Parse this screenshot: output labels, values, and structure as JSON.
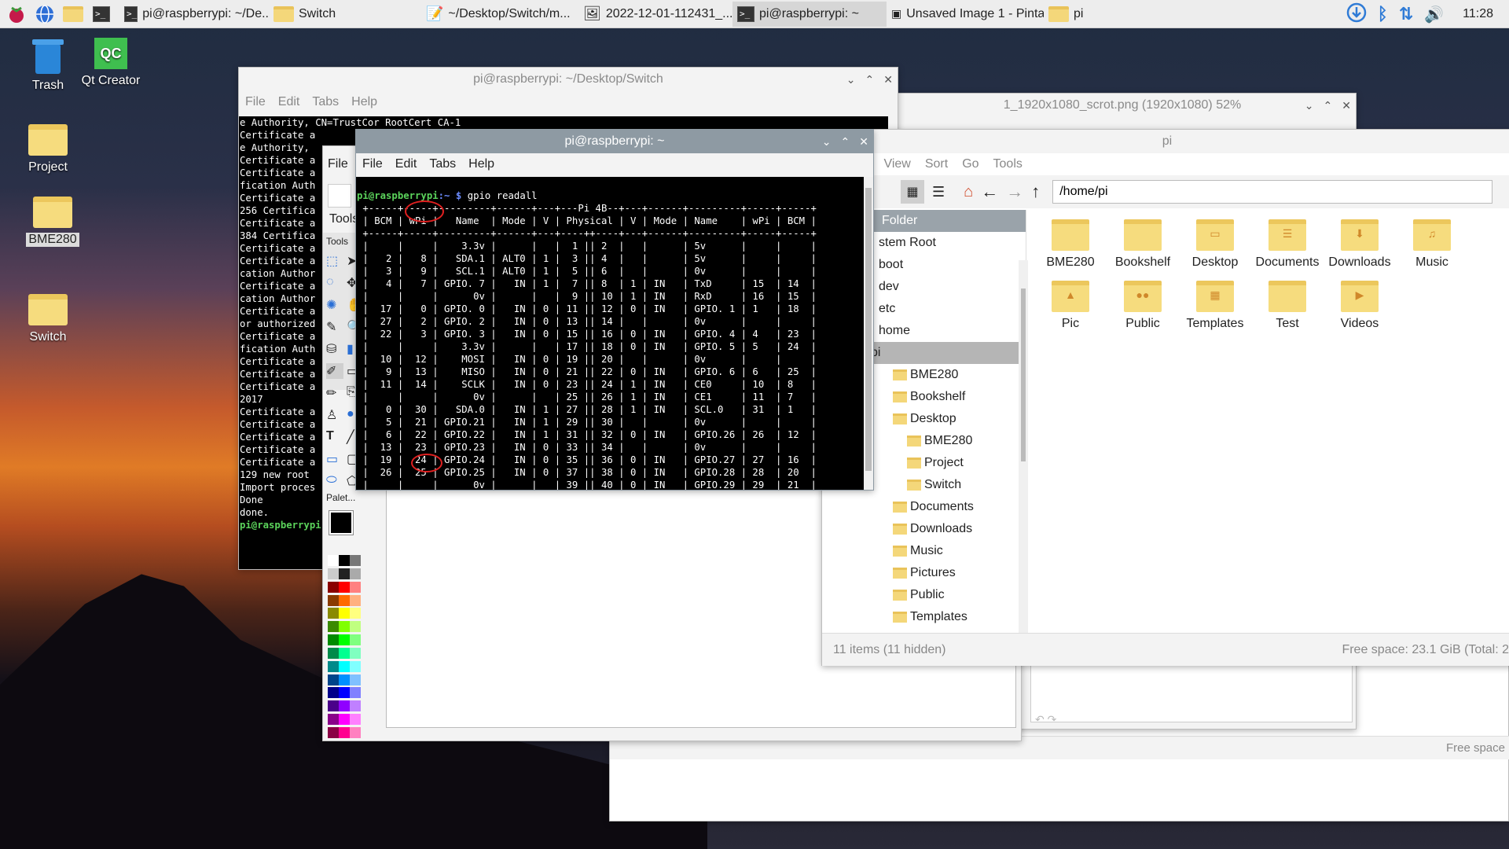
{
  "taskbar": {
    "tasks": [
      "pi@raspberrypi: ~/De...",
      "Switch",
      "~/Desktop/Switch/m...",
      "2022-12-01-112431_...",
      "pi@raspberrypi: ~",
      "Unsaved Image 1 - Pinta",
      "pi"
    ],
    "clock": "11:28"
  },
  "desktop": {
    "icons": [
      "Trash",
      "Qt Creator",
      "Project",
      "BME280",
      "Switch"
    ]
  },
  "term_back": {
    "title": "pi@raspberrypi: ~/Desktop/Switch",
    "menu": [
      "File",
      "Edit",
      "Tabs",
      "Help"
    ],
    "lines": [
      "e Authority, CN=TrustCor RootCert CA-1",
      "Certificate a",
      "e Authority,",
      "Certificate a",
      "Certificate a",
      "fication Auth",
      "Certificate a",
      "256 Certifica",
      "Certificate a",
      "384 Certifica",
      "Certificate a",
      "Certificate a",
      "cation Author",
      "Certificate a",
      "cation Author",
      "Certificate a",
      "or authorized",
      "Certificate a",
      "fication Auth",
      "Certificate a",
      "Certificate a",
      "Certificate a",
      "2017",
      "Certificate a",
      "Certificate a",
      "Certificate a",
      "Certificate a",
      "Certificate a",
      "129 new root",
      "Import proces",
      "Done",
      "done."
    ],
    "prompt": "pi@raspberrypi"
  },
  "image_viewer": {
    "title": "1_1920x1080_scrot.png (1920x1080) 52%"
  },
  "pinta": {
    "menu_file": "File",
    "tools_label": "Tools",
    "tools_small": "Tools",
    "palette_label": "Palet..."
  },
  "term_front": {
    "title": "pi@raspberrypi: ~",
    "menu": [
      "File",
      "Edit",
      "Tabs",
      "Help"
    ],
    "prompt_user": "pi@raspberrypi",
    "prompt_path": ":~ $ ",
    "command": "gpio readall",
    "output": [
      " +-----+-----+---------+------+---+---Pi 4B--+---+------+---------+-----+-----+",
      " | BCM | wPi |   Name  | Mode | V | Physical | V | Mode | Name    | wPi | BCM |",
      " +-----+-----+---------+------+---+----++----+---+------+---------+-----+-----+",
      " |     |     |    3.3v |      |   |  1 || 2  |   |      | 5v      |     |     |",
      " |   2 |   8 |   SDA.1 | ALT0 | 1 |  3 || 4  |   |      | 5v      |     |     |",
      " |   3 |   9 |   SCL.1 | ALT0 | 1 |  5 || 6  |   |      | 0v      |     |     |",
      " |   4 |   7 | GPIO. 7 |   IN | 1 |  7 || 8  | 1 | IN   | TxD     | 15  | 14  |",
      " |     |     |      0v |      |   |  9 || 10 | 1 | IN   | RxD     | 16  | 15  |",
      " |  17 |   0 | GPIO. 0 |   IN | 0 | 11 || 12 | 0 | IN   | GPIO. 1 | 1   | 18  |",
      " |  27 |   2 | GPIO. 2 |   IN | 0 | 13 || 14 |   |      | 0v      |     |     |",
      " |  22 |   3 | GPIO. 3 |   IN | 0 | 15 || 16 | 0 | IN   | GPIO. 4 | 4   | 23  |",
      " |     |     |    3.3v |      |   | 17 || 18 | 0 | IN   | GPIO. 5 | 5   | 24  |",
      " |  10 |  12 |    MOSI |   IN | 0 | 19 || 20 |   |      | 0v      |     |     |",
      " |   9 |  13 |    MISO |   IN | 0 | 21 || 22 | 0 | IN   | GPIO. 6 | 6   | 25  |",
      " |  11 |  14 |    SCLK |   IN | 0 | 23 || 24 | 1 | IN   | CE0     | 10  | 8   |",
      " |     |     |      0v |      |   | 25 || 26 | 1 | IN   | CE1     | 11  | 7   |",
      " |   0 |  30 |   SDA.0 |   IN | 1 | 27 || 28 | 1 | IN   | SCL.0   | 31  | 1   |",
      " |   5 |  21 | GPIO.21 |   IN | 1 | 29 || 30 |   |      | 0v      |     |     |",
      " |   6 |  22 | GPIO.22 |   IN | 1 | 31 || 32 | 0 | IN   | GPIO.26 | 26  | 12  |",
      " |  13 |  23 | GPIO.23 |   IN | 0 | 33 || 34 |   |      | 0v      |     |     |",
      " |  19 |  24 | GPIO.24 |   IN | 0 | 35 || 36 | 0 | IN   | GPIO.27 | 27  | 16  |",
      " |  26 |  25 | GPIO.25 |   IN | 0 | 37 || 38 | 0 | IN   | GPIO.28 | 28  | 20  |",
      " |     |     |      0v |      |   | 39 || 40 | 0 | IN   | GPIO.29 | 29  | 21  |",
      " +-----+-----+---------+------+---+----++----+---+------+---------+-----+-----+"
    ]
  },
  "file_manager": {
    "title": "pi",
    "menu": [
      "t",
      "View",
      "Sort",
      "Go",
      "Tools"
    ],
    "path": "/home/pi",
    "sidebar_header": "Folder",
    "tree": [
      {
        "label": "stem Root",
        "indent": 0,
        "sel": false,
        "folder": false
      },
      {
        "label": "boot",
        "indent": 0,
        "sel": false,
        "folder": false
      },
      {
        "label": "dev",
        "indent": 0,
        "sel": false,
        "folder": false
      },
      {
        "label": "etc",
        "indent": 0,
        "sel": false,
        "folder": false
      },
      {
        "label": "home",
        "indent": 0,
        "sel": false,
        "folder": false
      },
      {
        "label": "pi",
        "indent": 0,
        "sel": true,
        "folder": false
      },
      {
        "label": "BME280",
        "indent": 1,
        "sel": false,
        "folder": true
      },
      {
        "label": "Bookshelf",
        "indent": 1,
        "sel": false,
        "folder": true
      },
      {
        "label": "Desktop",
        "indent": 1,
        "sel": false,
        "folder": true
      },
      {
        "label": "BME280",
        "indent": 2,
        "sel": false,
        "folder": true
      },
      {
        "label": "Project",
        "indent": 2,
        "sel": false,
        "folder": true
      },
      {
        "label": "Switch",
        "indent": 2,
        "sel": false,
        "folder": true
      },
      {
        "label": "Documents",
        "indent": 1,
        "sel": false,
        "folder": true
      },
      {
        "label": "Downloads",
        "indent": 1,
        "sel": false,
        "folder": true
      },
      {
        "label": "Music",
        "indent": 1,
        "sel": false,
        "folder": true
      },
      {
        "label": "Pictures",
        "indent": 1,
        "sel": false,
        "folder": true
      },
      {
        "label": "Public",
        "indent": 1,
        "sel": false,
        "folder": true
      },
      {
        "label": "Templates",
        "indent": 1,
        "sel": false,
        "folder": true
      }
    ],
    "items": [
      "BME280",
      "Bookshelf",
      "Desktop",
      "Documents",
      "Downloads",
      "Music",
      "Pic",
      "Public",
      "Templates",
      "Test",
      "Videos"
    ],
    "status_left": "11 items (11 hidden)",
    "status_right": "Free space: 23.1 GiB (Total: 2"
  },
  "back_window": {
    "status_right": "Free space"
  },
  "colors": {
    "accent": "#2f7bd6",
    "folder": "#f6dc7e",
    "highlight": "#e02020"
  }
}
